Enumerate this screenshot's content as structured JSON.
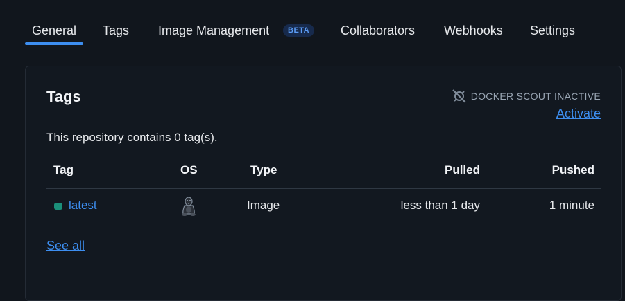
{
  "tabs": [
    {
      "label": "General",
      "active": true
    },
    {
      "label": "Tags"
    },
    {
      "label": "Image Management",
      "badge": "BETA"
    },
    {
      "label": "Collaborators"
    },
    {
      "label": "Webhooks"
    },
    {
      "label": "Settings"
    }
  ],
  "tags_card": {
    "title": "Tags",
    "scout_status": "DOCKER SCOUT INACTIVE",
    "scout_icon": "scout-off-icon",
    "activate_label": "Activate",
    "repo_summary": "This repository contains 0 tag(s).",
    "columns": [
      "Tag",
      "OS",
      "Type",
      "Pulled",
      "Pushed"
    ],
    "rows": [
      {
        "tag": "latest",
        "os_icon": "linux-icon",
        "type": "Image",
        "pulled": "less than 1 day",
        "pushed": "1 minute"
      }
    ],
    "see_all_label": "See all"
  },
  "colors": {
    "background": "#11161d",
    "accent": "#3d8ef0",
    "tag_status": "#1b8f7a"
  }
}
